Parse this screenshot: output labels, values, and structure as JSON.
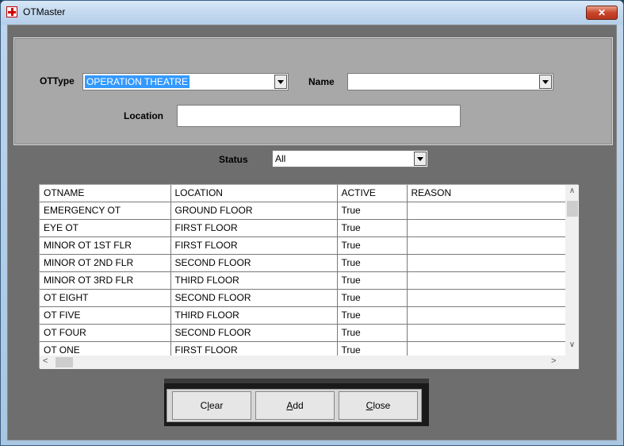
{
  "window": {
    "title": "OTMaster",
    "close_glyph": "✕"
  },
  "form": {
    "ottype_label": "OTType",
    "ottype_value": "OPERATION THEATRE",
    "name_label": "Name",
    "name_value": "",
    "location_label": "Location",
    "location_value": "",
    "status_label": "Status",
    "status_value": "All"
  },
  "grid": {
    "columns": [
      "OTNAME",
      "LOCATION",
      "ACTIVE",
      "REASON"
    ],
    "rows": [
      [
        "EMERGENCY OT",
        "GROUND FLOOR",
        "True",
        ""
      ],
      [
        "EYE OT",
        "FIRST FLOOR",
        "True",
        ""
      ],
      [
        "MINOR OT 1ST FLR",
        "FIRST FLOOR",
        "True",
        ""
      ],
      [
        "MINOR OT 2ND FLR",
        "SECOND FLOOR",
        "True",
        ""
      ],
      [
        "MINOR OT 3RD FLR",
        "THIRD FLOOR",
        "True",
        ""
      ],
      [
        "OT EIGHT",
        "SECOND FLOOR",
        "True",
        ""
      ],
      [
        "OT FIVE",
        "THIRD FLOOR",
        "True",
        ""
      ],
      [
        "OT FOUR",
        "SECOND FLOOR",
        "True",
        ""
      ],
      [
        "OT ONE",
        "FIRST FLOOR",
        "True",
        ""
      ]
    ]
  },
  "buttons": {
    "clear": {
      "first": "C",
      "mnemonic": "l",
      "rest": "ear"
    },
    "add": {
      "first": "",
      "mnemonic": "A",
      "rest": "dd"
    },
    "close": {
      "first": "",
      "mnemonic": "C",
      "rest": "lose"
    }
  },
  "icons": {
    "app": "red-cross-icon",
    "close": "close-icon"
  }
}
